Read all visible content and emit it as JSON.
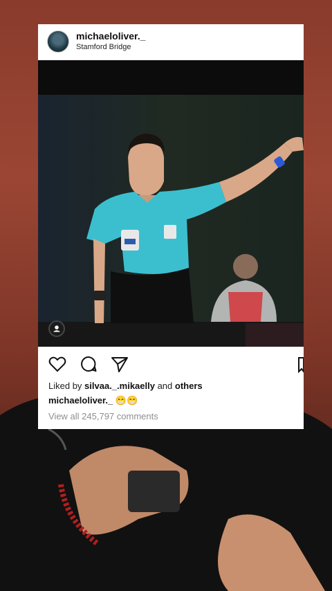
{
  "post": {
    "username": "michaeloliver._",
    "location": "Stamford Bridge",
    "liked_prefix": "Liked by ",
    "liked_user": "silvaa._.mikaelly",
    "liked_and": " and ",
    "liked_others": "others",
    "caption_user": "michaeloliver._",
    "caption_text": " 😁😁",
    "comments_link": "View all 245,797 comments"
  },
  "icons": [
    "heart-icon",
    "comment-icon",
    "share-icon",
    "bookmark-icon",
    "user-tag-icon"
  ],
  "colors": {
    "background": "#8a3b2c",
    "card": "#ffffff",
    "referee_shirt": "#3bbfcf",
    "muted_text": "#8e8e8e"
  }
}
